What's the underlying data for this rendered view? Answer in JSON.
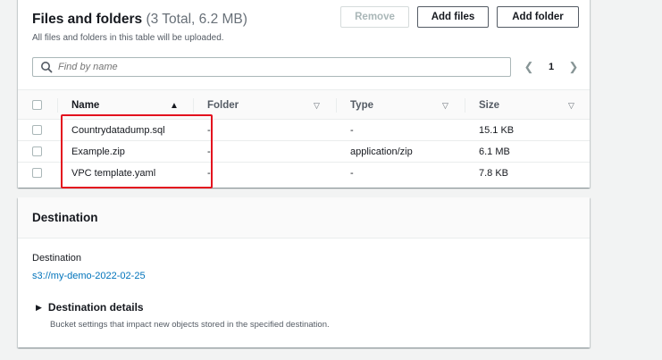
{
  "files_section": {
    "title": "Files and folders",
    "count_text": "(3 Total, 6.2 MB)",
    "description": "All files and folders in this table will be uploaded.",
    "buttons": {
      "remove": "Remove",
      "add_files": "Add files",
      "add_folder": "Add folder"
    },
    "search": {
      "placeholder": "Find by name"
    },
    "pagination": {
      "page": "1"
    },
    "table": {
      "columns": {
        "name": "Name",
        "folder": "Folder",
        "type": "Type",
        "size": "Size"
      },
      "rows": [
        {
          "name": "Countrydatadump.sql",
          "folder": "-",
          "type": "-",
          "size": "15.1 KB"
        },
        {
          "name": "Example.zip",
          "folder": "-",
          "type": "application/zip",
          "size": "6.1 MB"
        },
        {
          "name": "VPC template.yaml",
          "folder": "-",
          "type": "-",
          "size": "7.8 KB"
        }
      ]
    }
  },
  "destination_section": {
    "title": "Destination",
    "label": "Destination",
    "link": "s3://my-demo-2022-02-25",
    "details": {
      "label": "Destination details",
      "description": "Bucket settings that impact new objects stored in the specified destination."
    }
  },
  "colors": {
    "link": "#0073bb",
    "highlight_box": "#e3111e",
    "page_background": "#f2f3f3"
  }
}
